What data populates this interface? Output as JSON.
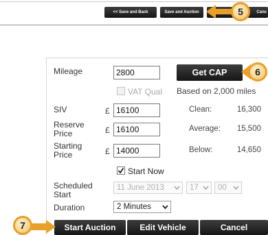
{
  "toolbar": {
    "save_back_label": "<< Save and Back",
    "save_auction_label": "Save and Auction",
    "cancel_partial_label": "Canc"
  },
  "callouts": {
    "five": "5",
    "six": "6",
    "seven": "7"
  },
  "form": {
    "mileage_label": "Mileage",
    "mileage_value": "2800",
    "get_cap_label": "Get CAP",
    "vat_label": "VAT Qual",
    "based_on_text": "Based on 2,000 miles",
    "siv_label": "SIV",
    "siv_value": "16100",
    "reserve_label_1": "Reserve",
    "reserve_label_2": "Price",
    "reserve_value": "16100",
    "starting_label_1": "Starting",
    "starting_label_2": "Price",
    "starting_value": "14000",
    "currency": "£",
    "start_now_label": "Start Now",
    "scheduled_label_1": "Scheduled",
    "scheduled_label_2": "Start",
    "scheduled_date": "11 June 2013",
    "scheduled_hour": "17",
    "scheduled_minute": "00",
    "duration_label": "Duration",
    "duration_value": "2 Minutes"
  },
  "valuations": {
    "clean_label": "Clean:",
    "clean_value": "16,300",
    "average_label": "Average:",
    "average_value": "15,500",
    "below_label": "Below:",
    "below_value": "14,650"
  },
  "actions": {
    "start_auction_label": "Start Auction",
    "edit_vehicle_label": "Edit Vehicle",
    "cancel_label": "Cancel"
  },
  "colors": {
    "accent_orange": "#e8a028",
    "button_dark": "#1f1f1f"
  }
}
